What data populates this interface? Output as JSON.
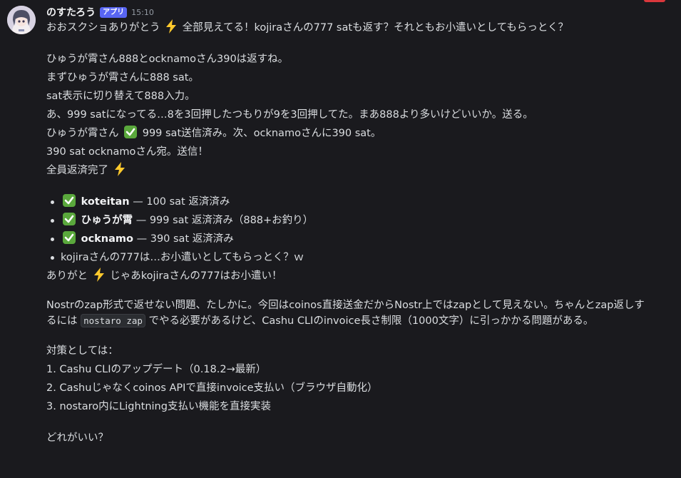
{
  "message": {
    "author": "のすたろう",
    "badge": "アプリ",
    "timestamp": "15:10",
    "line1": "おおスクショありがとう",
    "line1b": "全部見えてる！kojiraさんの777 satも返す？それともお小遣いとしてもらっとく？",
    "p2": [
      "ひゅうが霄さん888とocknamoさん390は返すね。",
      "まずひゅうが霄さんに888 sat。",
      "sat表示に切り替えて888入力。",
      "あ、999 satになってる…8を3回押したつもりが9を3回押してた。まあ888より多いけどいいか。送る。"
    ],
    "line_done_a": "ひゅうが霄さん",
    "line_done_b": "999 sat送信済み。次、ocknamoさんに390 sat。",
    "line_sent": "390 sat ocknamoさん宛。送信！",
    "line_complete": "全員返済完了",
    "bullets": [
      {
        "name": "koteitan",
        "rest": " — 100 sat 返済済み"
      },
      {
        "name": "ひゅうが霄",
        "rest": " — 999 sat 返済済み（888+お釣り）"
      },
      {
        "name": "ocknamo",
        "rest": " — 390 sat 返済済み"
      }
    ],
    "bullet4": "kojiraさんの777は…お小遣いとしてもらっとく？ｗ",
    "thanks_a": "ありがと",
    "thanks_b": "じゃあkojiraさんの777はお小遣い！",
    "nostr_a": "Nostrのzap形式で返せない問題、たしかに。今回はcoinos直接送金だからNostr上ではzapとして見えない。ちゃんとzap返しするには ",
    "nostr_code": "nostaro zap",
    "nostr_b": " でやる必要があるけど、Cashu CLIのinvoice長さ制限（1000文字）に引っかかる問題がある。",
    "options_title": "対策としては：",
    "options": [
      "1. Cashu CLIのアップデート（0.18.2→最新）",
      "2. Cashuじゃなくcoinos APIで直接invoice支払い（ブラウザ自動化）",
      "3. nostaro内にLightning支払い機能を直接実装"
    ],
    "question": "どれがいい？"
  },
  "colors": {
    "background": "#1a1a1e",
    "text": "#dbdee1",
    "badge": "#5865f2",
    "check": "#5aa83c",
    "bolt": "#ffc92c"
  },
  "icons": {
    "bolt": "high-voltage-emoji",
    "check": "white-check-mark-emoji"
  }
}
